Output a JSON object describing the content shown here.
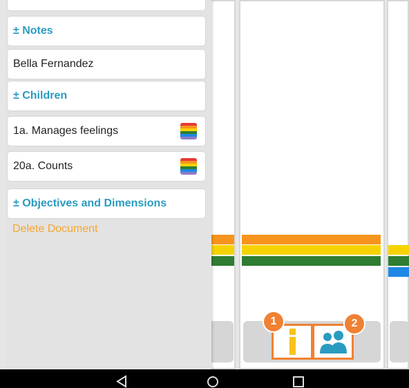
{
  "panel": {
    "cards": [
      {
        "label": "± Notes",
        "kind": "header"
      },
      {
        "label": "Bella Fernandez",
        "kind": "text"
      },
      {
        "label": "± Children",
        "kind": "header"
      },
      {
        "label": "1a. Manages feelings",
        "kind": "text",
        "rainbow": true
      },
      {
        "label": "20a. Counts",
        "kind": "text",
        "rainbow": true
      },
      {
        "label": "± Objectives and Dimensions",
        "kind": "header"
      }
    ],
    "delete_label": "Delete Document"
  },
  "badges": {
    "one": "1",
    "two": "2"
  },
  "colors": {
    "accent": "#2a9bc0",
    "delete": "#f6a531",
    "orange": "#f7941d",
    "yellow": "#f6d300",
    "green": "#2e7d32",
    "blue": "#1e88e5",
    "badge": "#f08133"
  },
  "icons": {
    "info": "info-icon",
    "people": "people-icon",
    "back": "back-triangle-icon",
    "home": "home-circle-icon",
    "recents": "recents-square-icon"
  }
}
